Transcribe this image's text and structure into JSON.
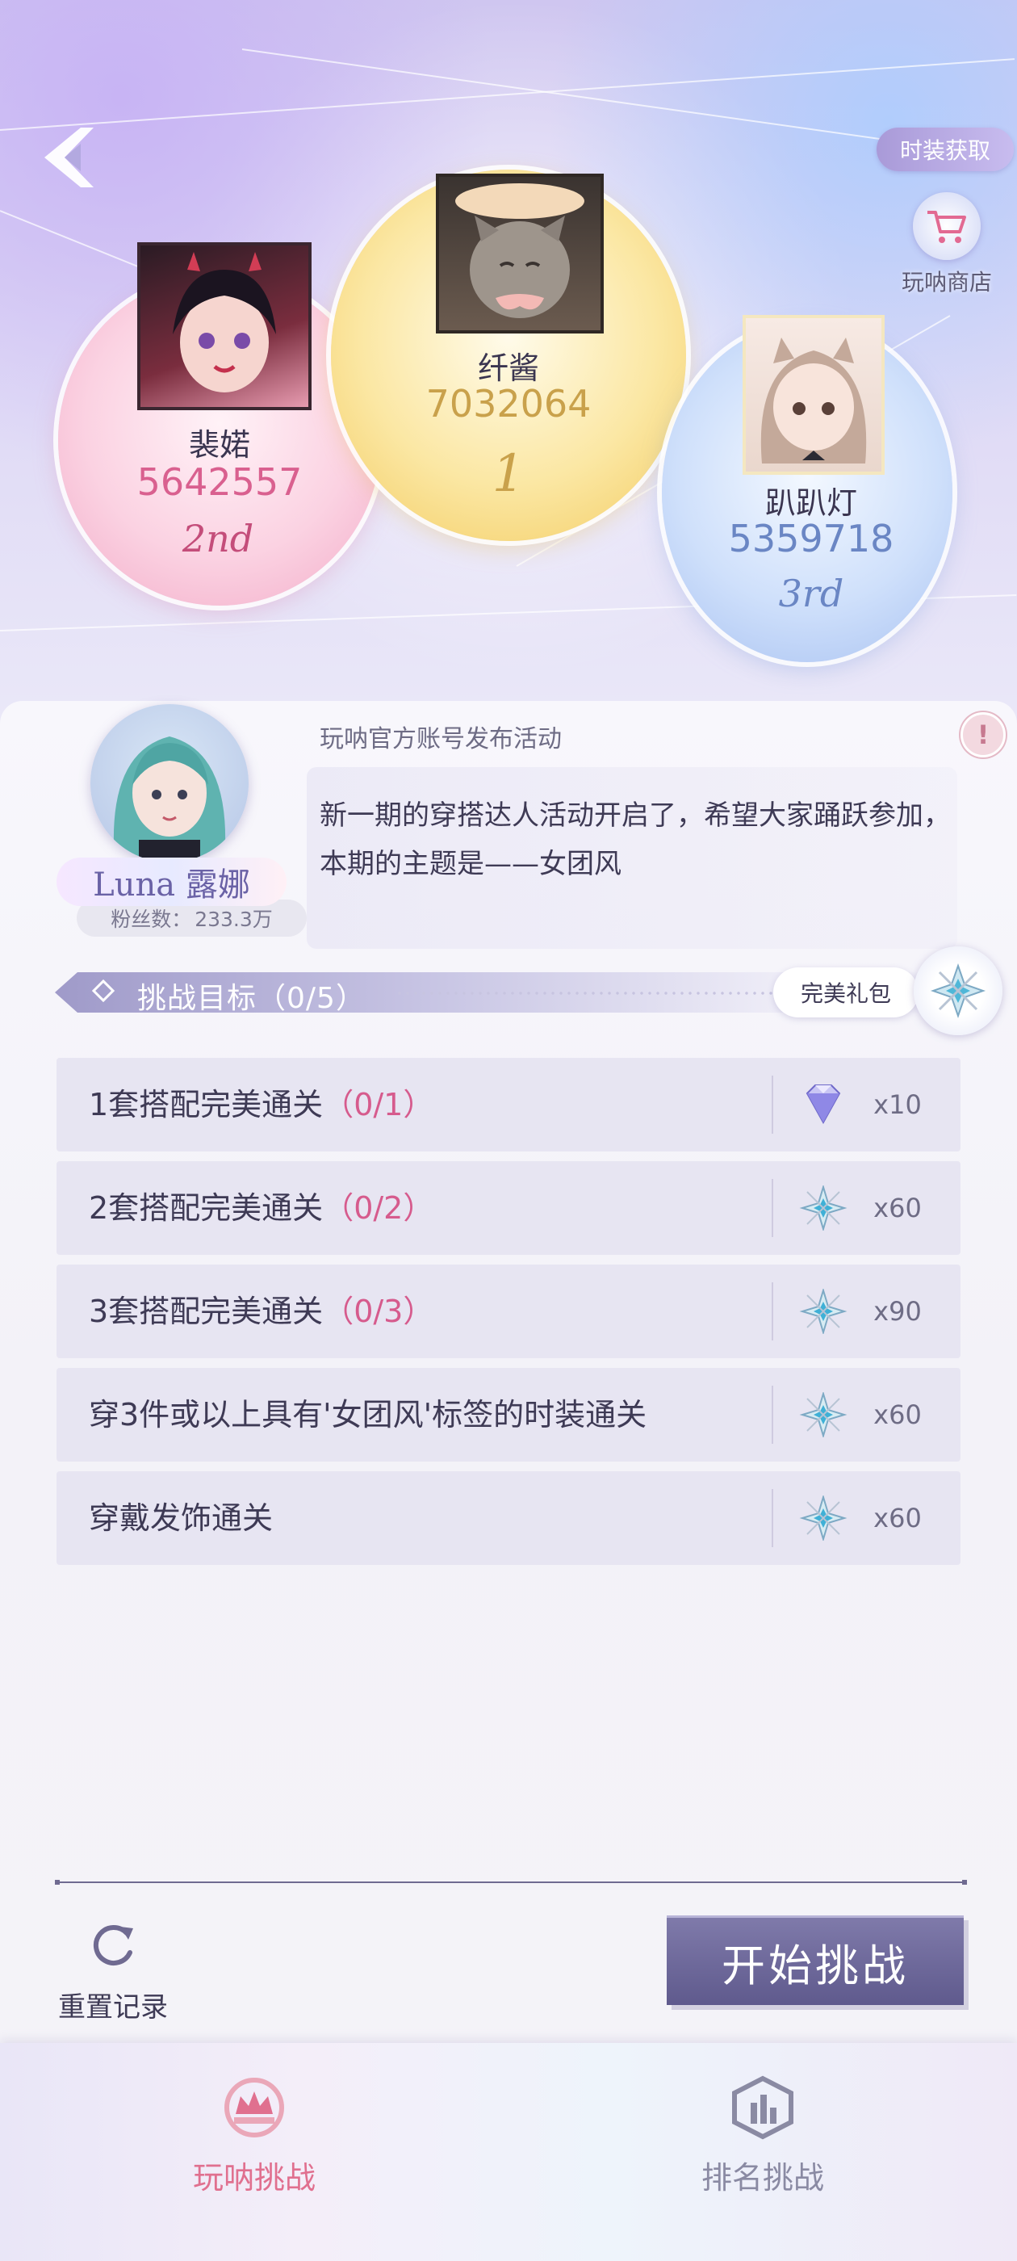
{
  "header": {
    "fashion_acquire_label": "时装获取",
    "shop_label": "玩呐商店"
  },
  "ranking": [
    {
      "rank_text": "1",
      "name": "纤酱",
      "score": "7032064",
      "score_color": "#c9a14b"
    },
    {
      "rank_text": "2nd",
      "name": "裴婼",
      "score": "5642557",
      "score_color": "#d9608f"
    },
    {
      "rank_text": "3rd",
      "name": "趴趴灯",
      "score": "5359718",
      "score_color": "#6a86c4"
    }
  ],
  "activity": {
    "host_name": "Luna 露娜",
    "fans_label": "粉丝数：",
    "fans_value": "233.3万",
    "source": "玩呐官方账号发布活动",
    "description": "新一期的穿搭达人活动开启了，希望大家踊跃参加，本期的主题是——女团风"
  },
  "challenge": {
    "title": "挑战目标（0/5）",
    "perfect_gift_label": "完美礼包",
    "tasks": [
      {
        "text": "1套搭配完美通关",
        "progress": "（0/1）",
        "reward_icon": "diamond-icon",
        "reward_count": "x10"
      },
      {
        "text": "2套搭配完美通关",
        "progress": "（0/2）",
        "reward_icon": "star-crystal-icon",
        "reward_count": "x60"
      },
      {
        "text": "3套搭配完美通关",
        "progress": "（0/3）",
        "reward_icon": "star-crystal-icon",
        "reward_count": "x90"
      },
      {
        "text": "穿3件或以上具有'女团风'标签的时装通关",
        "progress": "",
        "reward_icon": "star-crystal-icon",
        "reward_count": "x60"
      },
      {
        "text": "穿戴发饰通关",
        "progress": "",
        "reward_icon": "star-crystal-icon",
        "reward_count": "x60"
      }
    ]
  },
  "actions": {
    "reset_label": "重置记录",
    "start_label": "开始挑战"
  },
  "tabs": [
    {
      "label": "玩呐挑战",
      "active": true,
      "color": "#e0708f"
    },
    {
      "label": "排名挑战",
      "active": false,
      "color": "#8a8aa3"
    }
  ]
}
